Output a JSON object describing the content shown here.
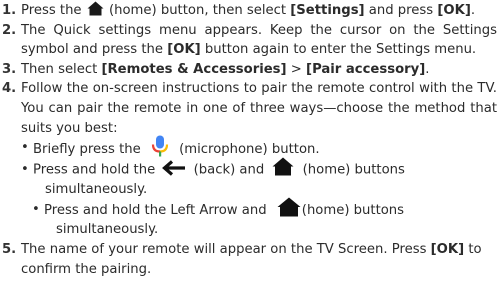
{
  "steps": [
    {
      "num": "1.",
      "t1": "Press the",
      "icon": "home-icon",
      "t2": "(home) button, then select",
      "b1": "[Settings]",
      "t3": "and press",
      "b2": "[OK]",
      "t4": "."
    },
    {
      "num": "2.",
      "t1": "The Quick settings menu appears. Keep the cursor on the Settings symbol and press the",
      "b1": "[OK]",
      "t2": "button again to enter the Settings menu."
    },
    {
      "num": "3.",
      "t1": "Then select",
      "b1": "[Remotes & Accessories]",
      "t2": ">",
      "b2": "[Pair accessory]",
      "t3": "."
    },
    {
      "num": "4.",
      "t1": "Follow the on-screen instructions to pair the remote control with the TV. You can pair the remote in one of three ways—choose the method that suits you best:",
      "bullets": [
        {
          "t1": "Briefly press the",
          "icon": "microphone-icon",
          "t2": "(microphone) button."
        },
        {
          "t1": "Press and hold the",
          "icon1": "back-arrow-icon",
          "t2": "(back) and",
          "icon2": "home-icon",
          "t3": "(home) buttons",
          "t4": "simultaneously."
        },
        {
          "t1": "Press and hold the Left Arrow and",
          "icon": "home-icon",
          "t2": "(home) buttons",
          "t3": "simultaneously."
        }
      ]
    },
    {
      "num": "5.",
      "t1": "The name of your remote will appear on the TV Screen. Press",
      "b1": "[OK]",
      "t2": "to confirm the pairing."
    }
  ],
  "bullet_char": "•",
  "colors": {
    "text": "#2b2b2b",
    "mic_blue": "#4285F4",
    "mic_red": "#EA4335",
    "mic_yellow": "#FBBC05",
    "mic_green": "#34A853"
  }
}
